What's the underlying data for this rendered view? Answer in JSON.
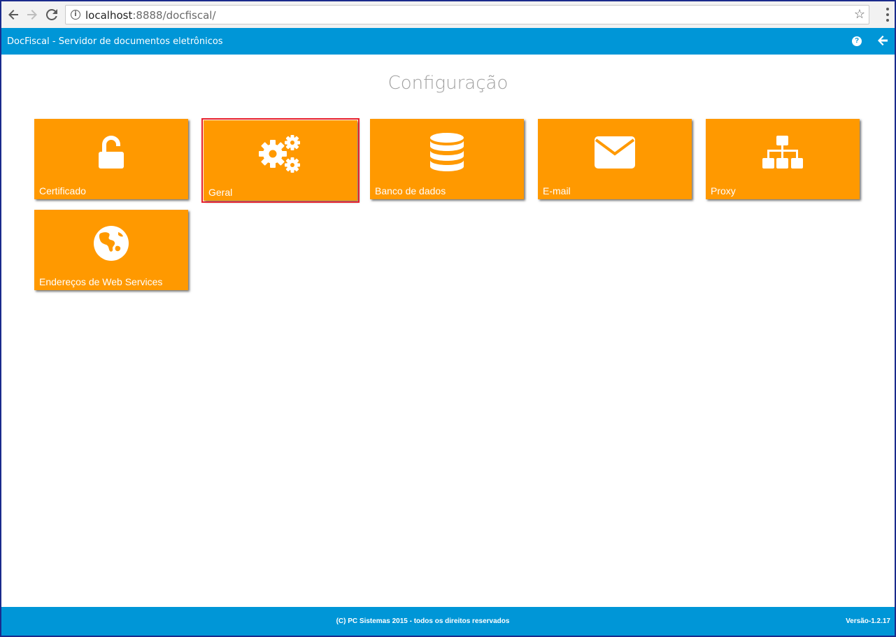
{
  "browser": {
    "url_host": "localhost",
    "url_rest": ":8888/docfiscal/"
  },
  "header": {
    "title": "DocFiscal - Servidor de documentos eletrônicos"
  },
  "page": {
    "title": "Configuração"
  },
  "tiles": [
    {
      "label": "Certificado",
      "icon": "unlock-icon",
      "selected": false
    },
    {
      "label": "Geral",
      "icon": "gears-icon",
      "selected": true
    },
    {
      "label": "Banco de dados",
      "icon": "database-icon",
      "selected": false
    },
    {
      "label": "E-mail",
      "icon": "envelope-icon",
      "selected": false
    },
    {
      "label": "Proxy",
      "icon": "sitemap-icon",
      "selected": false
    },
    {
      "label": "Endereços de Web Services",
      "icon": "globe-icon",
      "selected": false
    }
  ],
  "footer": {
    "copyright": "(C) PC Sistemas 2015 - todos os direitos reservados",
    "version": "Versão-1.2.17"
  },
  "colors": {
    "header": "#0096d7",
    "tile": "#ff9900",
    "selected_outline": "#e8202a"
  }
}
